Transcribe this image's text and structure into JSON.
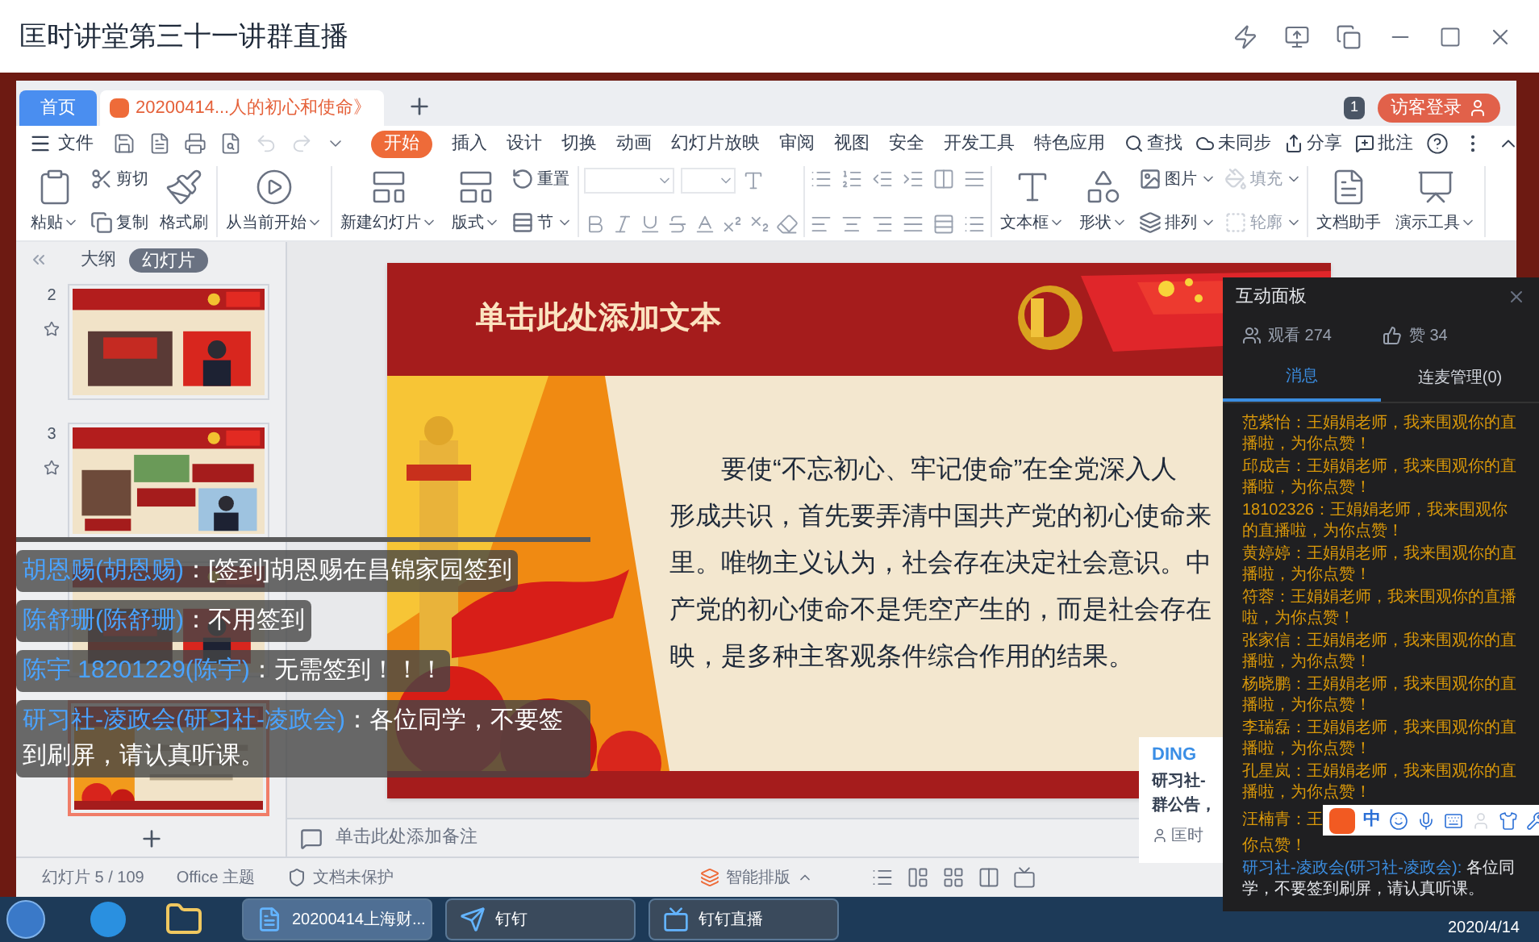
{
  "window": {
    "title": "匡时讲堂第三十一讲群直播"
  },
  "wps": {
    "tabs": [
      {
        "label": "首页",
        "kind": "home",
        "selected": false
      },
      {
        "label": "20200414...人的初心和使命》",
        "kind": "doc",
        "selected": true
      }
    ],
    "page_badge": "1",
    "login": "访客登录",
    "file_menu": "文件",
    "menu": [
      {
        "label": "开始",
        "selected": true
      },
      {
        "label": "插入",
        "selected": false
      },
      {
        "label": "设计",
        "selected": false
      },
      {
        "label": "切换",
        "selected": false
      },
      {
        "label": "动画",
        "selected": false
      },
      {
        "label": "幻灯片放映",
        "selected": false
      },
      {
        "label": "审阅",
        "selected": false
      },
      {
        "label": "视图",
        "selected": false
      },
      {
        "label": "安全",
        "selected": false
      },
      {
        "label": "开发工具",
        "selected": false
      },
      {
        "label": "特色应用",
        "selected": false
      }
    ],
    "search": "查找",
    "right_menu": [
      "未同步",
      "分享",
      "批注"
    ],
    "ribbon": [
      {
        "items": [
          {
            "kind": "large",
            "label": "粘贴",
            "dropdown": true,
            "disabled": false
          },
          {
            "kind": "stack",
            "items": [
              {
                "label": "剪切",
                "dropdown": false,
                "disabled": false
              },
              {
                "label": "复制",
                "dropdown": false,
                "disabled": false
              }
            ]
          },
          {
            "kind": "large",
            "label": "格式刷",
            "dropdown": false,
            "disabled": false
          }
        ]
      },
      {
        "items": [
          {
            "kind": "large",
            "label": "从当前开始",
            "dropdown": true,
            "disabled": false
          }
        ]
      },
      {
        "items": [
          {
            "kind": "large",
            "label": "新建幻灯片",
            "dropdown": true,
            "disabled": false
          },
          {
            "kind": "large",
            "label": "版式",
            "dropdown": true,
            "disabled": false
          },
          {
            "kind": "stack",
            "items": [
              {
                "label": "重置",
                "dropdown": false,
                "disabled": false
              },
              {
                "label": "节",
                "dropdown": true,
                "disabled": false
              }
            ]
          }
        ]
      },
      {
        "items": [
          {
            "kind": "font"
          }
        ]
      },
      {
        "items": [
          {
            "kind": "paragraph"
          }
        ]
      },
      {
        "items": [
          {
            "kind": "large",
            "label": "文本框",
            "dropdown": true,
            "disabled": false
          },
          {
            "kind": "large",
            "label": "形状",
            "dropdown": true,
            "disabled": false
          },
          {
            "kind": "stack",
            "items": [
              {
                "label": "图片",
                "dropdown": true,
                "disabled": false
              },
              {
                "label": "排列",
                "dropdown": true,
                "disabled": false
              }
            ]
          },
          {
            "kind": "stack",
            "items": [
              {
                "label": "填充",
                "dropdown": true,
                "disabled": true
              },
              {
                "label": "轮廓",
                "dropdown": true,
                "disabled": true
              }
            ]
          }
        ]
      },
      {
        "items": [
          {
            "kind": "large",
            "label": "文档助手",
            "dropdown": false,
            "disabled": false
          },
          {
            "kind": "large",
            "label": "演示工具",
            "dropdown": true,
            "disabled": false
          }
        ]
      }
    ],
    "side_tabs": [
      {
        "label": "大纲",
        "selected": false
      },
      {
        "label": "幻灯片",
        "selected": true
      }
    ],
    "thumbnails": [
      {
        "number": "2",
        "selected": false
      },
      {
        "number": "3",
        "selected": false
      },
      {
        "selected": false
      },
      {
        "selected": true
      }
    ],
    "slide": {
      "title": "单击此处添加文本",
      "lines": [
        "要使“不忘初心、牢记使命”在全党深入人",
        "形成共识，首先要弄清中国共产党的初心使命来",
        "里。唯物主义认为，社会存在决定社会意识。中",
        "产党的初心使命不是凭空产生的，而是社会存在",
        "映，是多种主客观条件综合作用的结果。"
      ]
    },
    "notes_placeholder": "单击此处添加备注",
    "status": {
      "slide": "幻灯片 5 / 109",
      "theme": "Office 主题",
      "protection": "文档未保护",
      "smart_layout": "智能排版"
    }
  },
  "danmaku": [
    {
      "user": "胡恩赐(胡恩赐)",
      "text": "：[签到]胡恩赐在昌锦家园签到"
    },
    {
      "user": "陈舒珊(陈舒珊)",
      "text": "：不用签到"
    },
    {
      "user": "陈宇 18201229(陈宇)",
      "text": "：无需签到！！！"
    },
    {
      "user": "研习社-凌政会(研习社-凌政会)",
      "text": "：各位同学，不要签到刷屏，请认真听课。"
    }
  ],
  "ding": {
    "title": "DING",
    "lines": [
      "研习社-",
      "群公告，"
    ],
    "sender": "匡时"
  },
  "panel": {
    "title": "互动面板",
    "viewers": "观看 274",
    "likes": "赞 34",
    "tabs": [
      {
        "label": "消息",
        "selected": true
      },
      {
        "label": "连麦管理(0)",
        "selected": false
      }
    ],
    "messages": [
      {
        "kind": "like",
        "user": "范紫怡",
        "text": "：王娟娟老师，我来围观你的直播啦，为你点赞！"
      },
      {
        "kind": "like",
        "user": "邱成吉",
        "text": "：王娟娟老师，我来围观你的直播啦，为你点赞！"
      },
      {
        "kind": "like",
        "user": "18102326",
        "text": "：王娟娟老师，我来围观你的直播啦，为你点赞！"
      },
      {
        "kind": "like",
        "user": "黄婷婷",
        "text": "：王娟娟老师，我来围观你的直播啦，为你点赞！"
      },
      {
        "kind": "like",
        "user": "符蓉",
        "text": "：王娟娟老师，我来围观你的直播啦，为你点赞！"
      },
      {
        "kind": "like",
        "user": "张家信",
        "text": "：王娟娟老师，我来围观你的直播啦，为你点赞！"
      },
      {
        "kind": "like",
        "user": "杨晓鹏",
        "text": "：王娟娟老师，我来围观你的直播啦，为你点赞！"
      },
      {
        "kind": "like",
        "user": "李瑞磊",
        "text": "：王娟娟老师，我来围观你的直播啦，为你点赞！"
      },
      {
        "kind": "like",
        "user": "孔星岚",
        "text": "：王娟娟老师，我来围观你的直播啦，为你点赞！"
      },
      {
        "kind": "covered",
        "user": "汪楠青",
        "text": "：王",
        "tail": "你点赞！"
      },
      {
        "kind": "chat",
        "user": "研习社-凌政会(研习社-凌政会):",
        "text": " 各位同学，不要签到刷屏，请认真听课。"
      }
    ]
  },
  "ime_bar": {
    "mode": "中"
  },
  "taskbar": {
    "items": [
      {
        "label": "20200414上海财...",
        "selected": true
      },
      {
        "label": "钉钉",
        "selected": false
      },
      {
        "label": "钉钉直播",
        "selected": false
      }
    ],
    "date": "2020/4/14"
  }
}
